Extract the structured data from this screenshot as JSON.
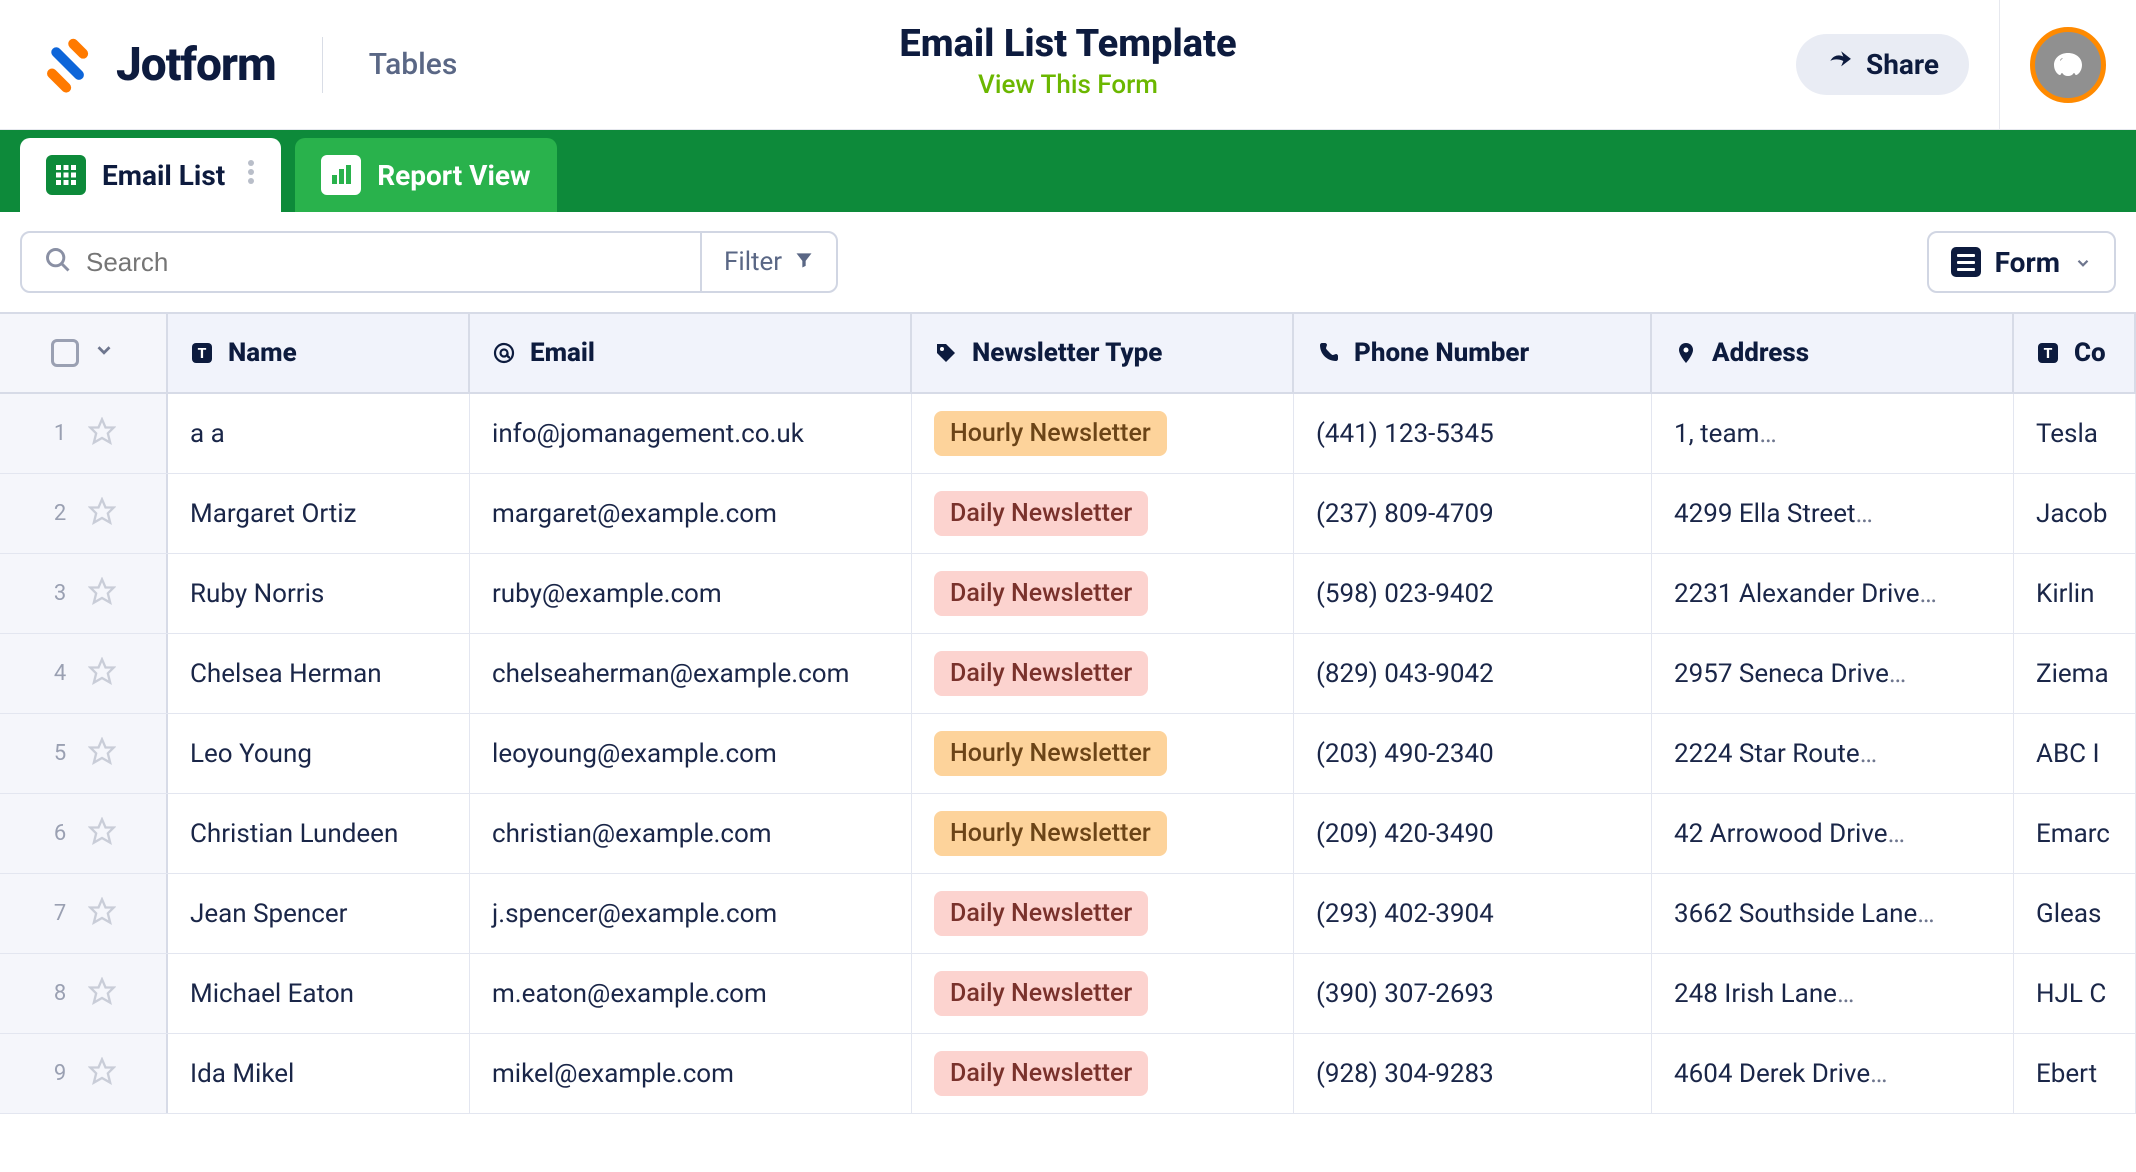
{
  "brand": {
    "logo_text": "Jotform",
    "section": "Tables"
  },
  "title": {
    "main": "Email List Template",
    "sub": "View This Form"
  },
  "topbar": {
    "share_label": "Share"
  },
  "tabs": [
    {
      "label": "Email List",
      "active": true,
      "icon": "grid-icon"
    },
    {
      "label": "Report View",
      "active": false,
      "icon": "bar-chart-icon"
    }
  ],
  "toolbar": {
    "search_placeholder": "Search",
    "filter_label": "Filter",
    "form_label": "Form"
  },
  "columns": {
    "name": "Name",
    "email": "Email",
    "newsletter": "Newsletter Type",
    "phone": "Phone Number",
    "address": "Address",
    "company": "Co"
  },
  "newsletter_styles": {
    "Hourly Newsletter": "hourly",
    "Daily Newsletter": "daily"
  },
  "rows": [
    {
      "n": "1",
      "name": "a a",
      "email": "info@jomanagement.co.uk",
      "news": "Hourly Newsletter",
      "phone": "(441) 123-5345",
      "addr": "1, team",
      "addr_ellipsis": true,
      "company": "Tesla "
    },
    {
      "n": "2",
      "name": "Margaret Ortiz",
      "email": "margaret@example.com",
      "news": "Daily Newsletter",
      "phone": "(237) 809-4709",
      "addr": "4299 Ella Street",
      "addr_ellipsis": true,
      "company": "Jacob"
    },
    {
      "n": "3",
      "name": "Ruby Norris",
      "email": "ruby@example.com",
      "news": "Daily Newsletter",
      "phone": "(598) 023-9402",
      "addr": "2231 Alexander Drive",
      "addr_ellipsis": true,
      "company": "Kirlin "
    },
    {
      "n": "4",
      "name": "Chelsea Herman",
      "email": "chelseaherman@example.com",
      "news": "Daily Newsletter",
      "phone": "(829) 043-9042",
      "addr": "2957 Seneca Drive",
      "addr_ellipsis": true,
      "company": "Ziema"
    },
    {
      "n": "5",
      "name": "Leo Young",
      "email": "leoyoung@example.com",
      "news": "Hourly Newsletter",
      "phone": "(203) 490-2340",
      "addr": "2224 Star Route",
      "addr_ellipsis": true,
      "company": "ABC I"
    },
    {
      "n": "6",
      "name": "Christian Lundeen",
      "email": "christian@example.com",
      "news": "Hourly Newsletter",
      "phone": "(209) 420-3490",
      "addr": "42 Arrowood Drive",
      "addr_ellipsis": true,
      "company": "Emarc"
    },
    {
      "n": "7",
      "name": "Jean Spencer",
      "email": "j.spencer@example.com",
      "news": "Daily Newsletter",
      "phone": "(293) 402-3904",
      "addr": "3662 Southside Lane",
      "addr_ellipsis": true,
      "company": "Gleas"
    },
    {
      "n": "8",
      "name": "Michael Eaton",
      "email": "m.eaton@example.com",
      "news": "Daily Newsletter",
      "phone": "(390) 307-2693",
      "addr": "248 Irish Lane",
      "addr_ellipsis": true,
      "company": "HJL C"
    },
    {
      "n": "9",
      "name": "Ida Mikel",
      "email": "mikel@example.com",
      "news": "Daily Newsletter",
      "phone": "(928) 304-9283",
      "addr": "4604 Derek Drive",
      "addr_ellipsis": true,
      "company": "Ebert"
    }
  ]
}
